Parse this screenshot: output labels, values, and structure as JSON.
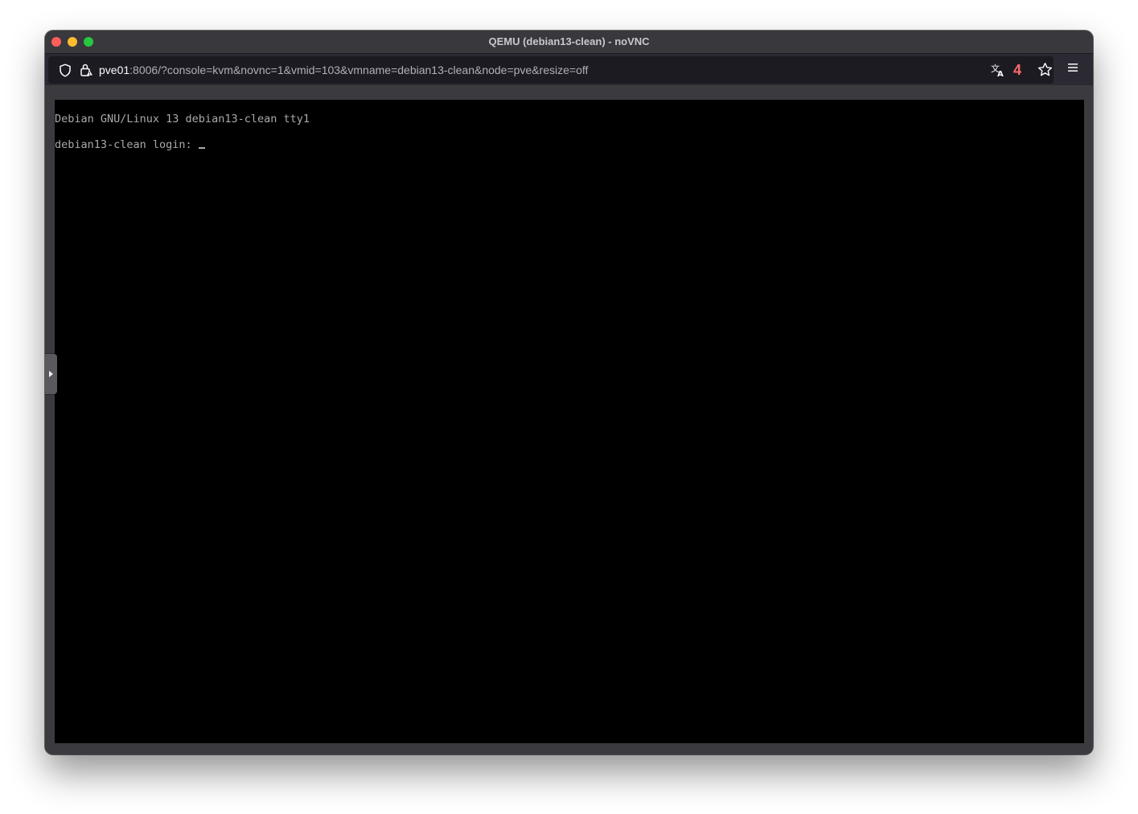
{
  "window": {
    "title": "QEMU (debian13-clean) - noVNC"
  },
  "toolbar": {
    "url_host": "pve01",
    "url_rest": ":8006/?console=kvm&novnc=1&vmid=103&vmname=debian13-clean&node=pve&resize=off",
    "extension_badge_count": "4",
    "icons": [
      "shield-icon",
      "lock-icon",
      "translate-icon",
      "star-icon",
      "menu-icon"
    ]
  },
  "console": {
    "lines": [
      "Debian GNU/Linux 13 debian13-clean tty1",
      "debian13-clean login: "
    ]
  },
  "colors": {
    "terminal_text": "#aaaaaa",
    "terminal_bg": "#000000",
    "badge": "#ff6a6a"
  }
}
